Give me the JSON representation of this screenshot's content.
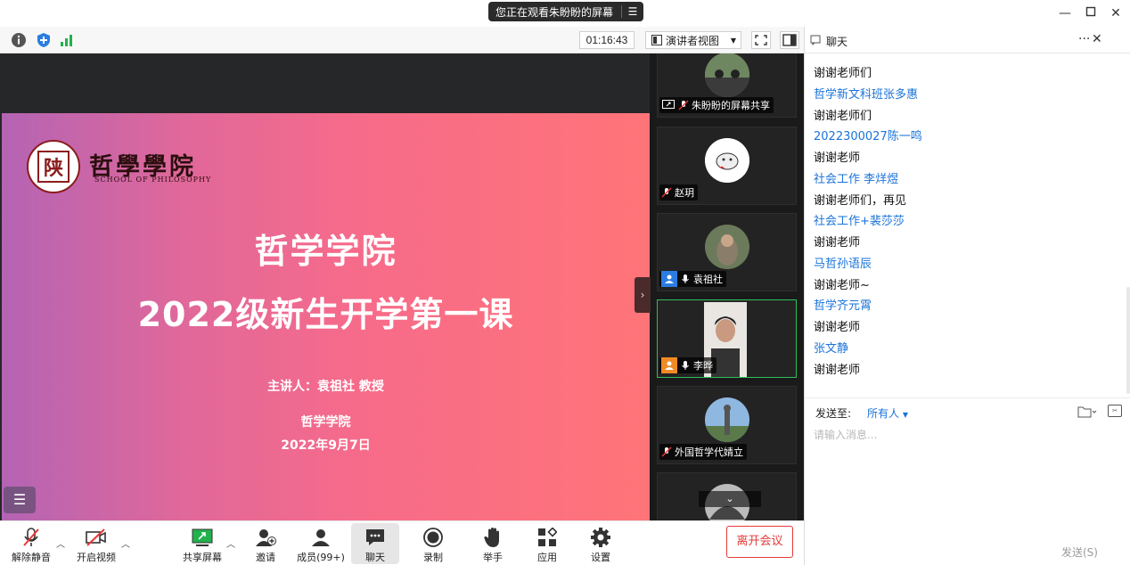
{
  "titlebar": {
    "share_banner": "您正在观看朱盼盼的屏幕",
    "share_menu_icon": "list-menu-icon",
    "window_controls": [
      "minimize-icon",
      "maximize-icon",
      "close-icon"
    ]
  },
  "toolbar": {
    "timer": "01:16:43",
    "view_mode": "演讲者视图",
    "icons": [
      "info-icon",
      "shield-icon",
      "signal-bars-icon",
      "fullscreen-icon",
      "sidebar-toggle-icon"
    ]
  },
  "slide": {
    "school_logo_char": "陕",
    "school_name": "哲學學院",
    "school_sub": "SCHOOL OF PHILOSOPHY",
    "title1": "哲学学院",
    "title2": "2022级新生开学第一课",
    "speaker": "主讲人：袁祖社  教授",
    "org": "哲学学院",
    "date": "2022年9月7日",
    "gradient": [
      "#b464b4",
      "#e0689a",
      "#f76b8a",
      "#ff7478"
    ]
  },
  "gallery": {
    "participants": [
      {
        "name": "朱盼盼的屏幕共享",
        "badge": "share"
      },
      {
        "name": "赵玥",
        "badge": ""
      },
      {
        "name": "袁祖社",
        "badge": "blue"
      },
      {
        "name": "李晔",
        "badge": "orange"
      },
      {
        "name": "外国哲学代婧立",
        "badge": ""
      }
    ],
    "active_border_color": "#2fbf5a"
  },
  "chat": {
    "title": "聊天",
    "more_icon": "more-dots-icon",
    "messages": [
      {
        "type": "text",
        "value": "谢谢老师们"
      },
      {
        "type": "name",
        "value": "哲学新文科班张多惠"
      },
      {
        "type": "text",
        "value": "谢谢老师们"
      },
      {
        "type": "name",
        "value": "2022300027陈一鸣"
      },
      {
        "type": "text",
        "value": "谢谢老师"
      },
      {
        "type": "name",
        "value": "社会工作 李烊煜"
      },
      {
        "type": "text",
        "value": "谢谢老师们，再见"
      },
      {
        "type": "name",
        "value": "社会工作+裴莎莎"
      },
      {
        "type": "text",
        "value": "谢谢老师"
      },
      {
        "type": "name",
        "value": "马哲孙语辰"
      },
      {
        "type": "text",
        "value": "谢谢老师~"
      },
      {
        "type": "name",
        "value": "哲学齐元霄"
      },
      {
        "type": "text",
        "value": "谢谢老师"
      },
      {
        "type": "name",
        "value": "张文静"
      },
      {
        "type": "text",
        "value": "谢谢老师"
      }
    ],
    "send_to_label": "发送至:",
    "send_to_value": "所有人",
    "input_placeholder": "请输入消息...",
    "send_button": "发送(S)",
    "name_color": "#1a73d9"
  },
  "controls": {
    "items": [
      {
        "label": "解除静音",
        "icon": "mic-muted-icon"
      },
      {
        "label": "开启视频",
        "icon": "video-off-icon"
      },
      {
        "label": "共享屏幕",
        "icon": "share-screen-icon"
      },
      {
        "label": "邀请",
        "icon": "invite-user-icon"
      },
      {
        "label": "成员(99+)",
        "icon": "participants-icon"
      },
      {
        "label": "聊天",
        "icon": "chat-icon"
      },
      {
        "label": "录制",
        "icon": "record-icon"
      },
      {
        "label": "举手",
        "icon": "raise-hand-icon"
      },
      {
        "label": "应用",
        "icon": "apps-icon"
      },
      {
        "label": "设置",
        "icon": "settings-icon"
      }
    ],
    "leave": "离开会议",
    "leave_color": "#e23b3b"
  }
}
